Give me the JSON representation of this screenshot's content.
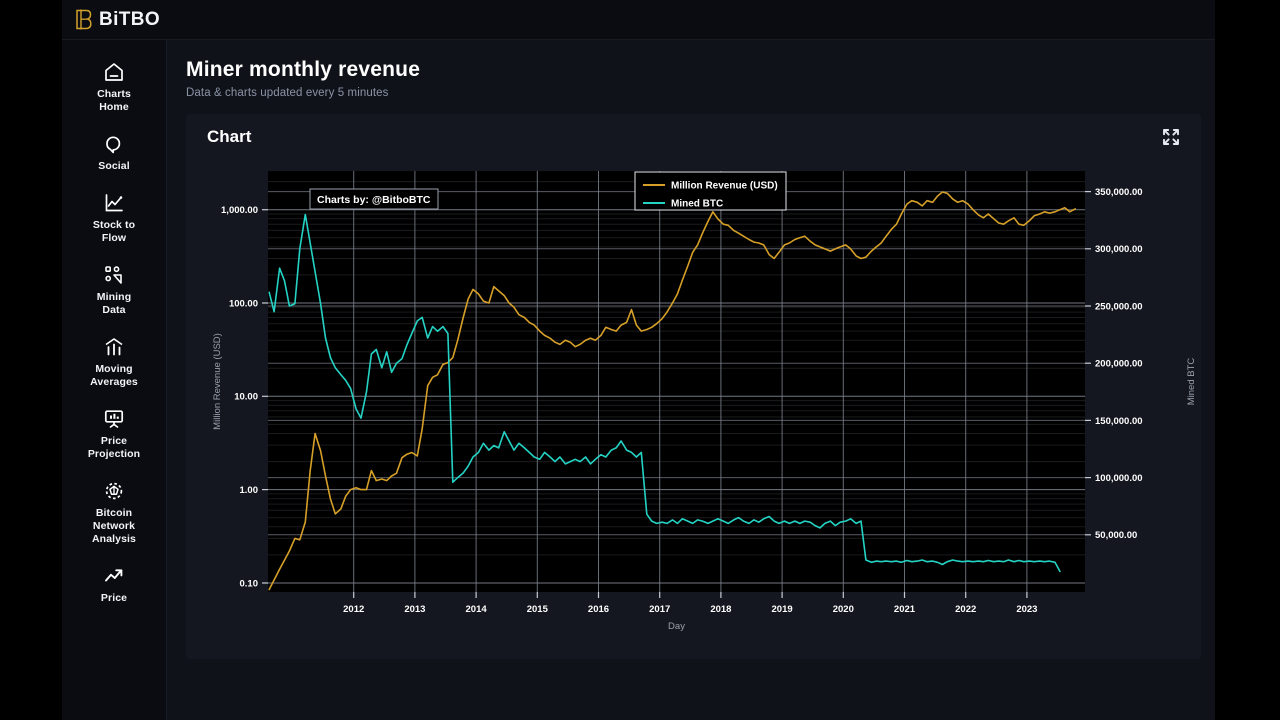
{
  "brand": {
    "name": "BiTBO",
    "logo_color": "#d4a12c"
  },
  "sidebar": {
    "items": [
      {
        "label": "Charts\nHome",
        "icon": "home-icon"
      },
      {
        "label": "Social",
        "icon": "chat-bubble-icon"
      },
      {
        "label": "Stock to\nFlow",
        "icon": "line-chart-icon"
      },
      {
        "label": "Mining\nData",
        "icon": "mining-nodes-icon"
      },
      {
        "label": "Moving\nAverages",
        "icon": "bar-chart-icon"
      },
      {
        "label": "Price\nProjection",
        "icon": "presentation-icon"
      },
      {
        "label": "Bitcoin\nNetwork\nAnalysis",
        "icon": "network-icon"
      },
      {
        "label": "Price",
        "icon": "trend-up-icon"
      }
    ]
  },
  "header": {
    "title": "Miner monthly revenue",
    "subtitle": "Data & charts updated every 5 minutes"
  },
  "card": {
    "title": "Chart",
    "expand_label": "Expand chart"
  },
  "watermark": "Charts by: @BitboBTC",
  "chart_data": {
    "type": "line",
    "title": "Miner monthly revenue",
    "xlabel": "Day",
    "ylabel": "Million Revenue (USD)",
    "y2label": "Mined BTC",
    "grid": true,
    "legend_position": "top-center",
    "yscale": "log",
    "ylim": [
      0.08,
      2600
    ],
    "yticks": [
      0.1,
      1,
      10,
      100,
      1000
    ],
    "ytick_labels": [
      "0.10",
      "1.00",
      "10.00",
      "100.00",
      "1,000.00"
    ],
    "y2scale": "linear",
    "y2lim": [
      0,
      368000
    ],
    "y2ticks": [
      50000,
      100000,
      150000,
      200000,
      250000,
      300000,
      350000
    ],
    "y2tick_labels": [
      "50,000.00",
      "100,000.00",
      "150,000.00",
      "200,000.00",
      "250,000.00",
      "300,000.00",
      "350,000.00"
    ],
    "xlim": [
      2010.6,
      2023.95
    ],
    "xticks": [
      2012,
      2013,
      2014,
      2015,
      2016,
      2017,
      2018,
      2019,
      2020,
      2021,
      2022,
      2023
    ],
    "xtick_labels": [
      "2012",
      "2013",
      "2014",
      "2015",
      "2016",
      "2017",
      "2018",
      "2019",
      "2020",
      "2021",
      "2022",
      "2023"
    ],
    "series": [
      {
        "name": "Million Revenue (USD)",
        "color": "#d6a028",
        "axis": "left",
        "x": [
          2010.62,
          2010.79,
          2010.95,
          2011.04,
          2011.12,
          2011.21,
          2011.29,
          2011.37,
          2011.46,
          2011.54,
          2011.62,
          2011.7,
          2011.79,
          2011.87,
          2011.95,
          2012.04,
          2012.12,
          2012.21,
          2012.29,
          2012.37,
          2012.46,
          2012.54,
          2012.62,
          2012.7,
          2012.79,
          2012.87,
          2012.95,
          2013.04,
          2013.12,
          2013.21,
          2013.29,
          2013.37,
          2013.46,
          2013.54,
          2013.62,
          2013.7,
          2013.79,
          2013.87,
          2013.95,
          2014.04,
          2014.12,
          2014.21,
          2014.29,
          2014.37,
          2014.46,
          2014.54,
          2014.62,
          2014.7,
          2014.79,
          2014.87,
          2014.95,
          2015.04,
          2015.12,
          2015.21,
          2015.29,
          2015.37,
          2015.46,
          2015.54,
          2015.62,
          2015.7,
          2015.79,
          2015.87,
          2015.95,
          2016.04,
          2016.12,
          2016.21,
          2016.29,
          2016.37,
          2016.46,
          2016.54,
          2016.62,
          2016.7,
          2016.79,
          2016.87,
          2016.95,
          2017.04,
          2017.12,
          2017.21,
          2017.29,
          2017.37,
          2017.46,
          2017.54,
          2017.62,
          2017.7,
          2017.79,
          2017.87,
          2017.95,
          2018.04,
          2018.12,
          2018.21,
          2018.29,
          2018.37,
          2018.46,
          2018.54,
          2018.62,
          2018.7,
          2018.79,
          2018.87,
          2018.95,
          2019.04,
          2019.12,
          2019.21,
          2019.29,
          2019.37,
          2019.46,
          2019.54,
          2019.62,
          2019.7,
          2019.79,
          2019.87,
          2019.95,
          2020.04,
          2020.12,
          2020.21,
          2020.29,
          2020.37,
          2020.46,
          2020.54,
          2020.62,
          2020.7,
          2020.79,
          2020.87,
          2020.95,
          2021.04,
          2021.12,
          2021.21,
          2021.29,
          2021.37,
          2021.46,
          2021.54,
          2021.62,
          2021.7,
          2021.79,
          2021.87,
          2021.95,
          2022.04,
          2022.12,
          2022.21,
          2022.29,
          2022.37,
          2022.46,
          2022.54,
          2022.62,
          2022.7,
          2022.79,
          2022.87,
          2022.95,
          2023.04,
          2023.12,
          2023.21,
          2023.29,
          2023.37,
          2023.46,
          2023.54,
          2023.62,
          2023.7,
          2023.79
        ],
        "y": [
          0.085,
          0.14,
          0.22,
          0.3,
          0.29,
          0.45,
          1.6,
          4.0,
          2.6,
          1.4,
          0.8,
          0.55,
          0.62,
          0.85,
          1.0,
          1.05,
          1.0,
          1.0,
          1.6,
          1.25,
          1.3,
          1.25,
          1.4,
          1.5,
          2.2,
          2.4,
          2.5,
          2.3,
          4.5,
          13.0,
          16.0,
          17.0,
          22.0,
          23.0,
          26.0,
          40.0,
          70.0,
          110.0,
          140.0,
          125.0,
          105.0,
          100.0,
          150.0,
          135.0,
          120.0,
          100.0,
          90.0,
          75.0,
          70.0,
          62.0,
          58.0,
          50.0,
          45.0,
          42.0,
          38.0,
          36.0,
          40.0,
          38.0,
          34.0,
          36.0,
          40.0,
          42.0,
          40.0,
          45.0,
          55.0,
          52.0,
          50.0,
          58.0,
          62.0,
          85.0,
          58.0,
          50.0,
          52.0,
          55.0,
          60.0,
          68.0,
          80.0,
          100.0,
          125.0,
          175.0,
          250.0,
          350.0,
          420.0,
          560.0,
          750.0,
          950.0,
          800.0,
          700.0,
          680.0,
          600.0,
          560.0,
          520.0,
          480.0,
          450.0,
          440.0,
          420.0,
          330.0,
          300.0,
          350.0,
          420.0,
          440.0,
          480.0,
          500.0,
          520.0,
          460.0,
          420.0,
          400.0,
          380.0,
          360.0,
          380.0,
          400.0,
          420.0,
          380.0,
          320.0,
          300.0,
          310.0,
          360.0,
          400.0,
          440.0,
          520.0,
          620.0,
          700.0,
          900.0,
          1150.0,
          1250.0,
          1200.0,
          1100.0,
          1250.0,
          1200.0,
          1400.0,
          1550.0,
          1500.0,
          1300.0,
          1200.0,
          1250.0,
          1150.0,
          1000.0,
          880.0,
          820.0,
          900.0,
          800.0,
          720.0,
          700.0,
          760.0,
          820.0,
          700.0,
          680.0,
          760.0,
          860.0,
          900.0,
          950.0,
          920.0,
          950.0,
          1000.0,
          1050.0,
          950.0,
          1020.0
        ]
      },
      {
        "name": "Mined BTC",
        "color": "#24d3c4",
        "axis": "right",
        "x": [
          2010.62,
          2010.7,
          2010.79,
          2010.87,
          2010.95,
          2011.04,
          2011.12,
          2011.21,
          2011.29,
          2011.37,
          2011.46,
          2011.54,
          2011.62,
          2011.7,
          2011.79,
          2011.87,
          2011.95,
          2012.04,
          2012.12,
          2012.21,
          2012.29,
          2012.37,
          2012.46,
          2012.54,
          2012.62,
          2012.7,
          2012.79,
          2012.87,
          2012.95,
          2013.04,
          2013.12,
          2013.21,
          2013.29,
          2013.37,
          2013.46,
          2013.54,
          2013.62,
          2013.7,
          2013.79,
          2013.87,
          2013.95,
          2014.04,
          2014.12,
          2014.21,
          2014.29,
          2014.37,
          2014.46,
          2014.54,
          2014.62,
          2014.7,
          2014.79,
          2014.87,
          2014.95,
          2015.04,
          2015.12,
          2015.21,
          2015.29,
          2015.37,
          2015.46,
          2015.54,
          2015.62,
          2015.7,
          2015.79,
          2015.87,
          2015.95,
          2016.04,
          2016.12,
          2016.21,
          2016.29,
          2016.37,
          2016.46,
          2016.54,
          2016.62,
          2016.7,
          2016.79,
          2016.87,
          2016.95,
          2017.04,
          2017.12,
          2017.21,
          2017.29,
          2017.37,
          2017.46,
          2017.54,
          2017.62,
          2017.7,
          2017.79,
          2017.87,
          2017.95,
          2018.04,
          2018.12,
          2018.21,
          2018.29,
          2018.37,
          2018.46,
          2018.54,
          2018.62,
          2018.7,
          2018.79,
          2018.87,
          2018.95,
          2019.04,
          2019.12,
          2019.21,
          2019.29,
          2019.37,
          2019.46,
          2019.54,
          2019.62,
          2019.7,
          2019.79,
          2019.87,
          2019.95,
          2020.04,
          2020.12,
          2020.21,
          2020.29,
          2020.37,
          2020.46,
          2020.54,
          2020.62,
          2020.7,
          2020.79,
          2020.87,
          2020.95,
          2021.04,
          2021.12,
          2021.21,
          2021.29,
          2021.37,
          2021.46,
          2021.54,
          2021.62,
          2021.7,
          2021.79,
          2021.87,
          2021.95,
          2022.04,
          2022.12,
          2022.21,
          2022.29,
          2022.37,
          2022.46,
          2022.54,
          2022.62,
          2022.7,
          2022.79,
          2022.87,
          2022.95,
          2023.04,
          2023.12,
          2023.21,
          2023.29,
          2023.37,
          2023.46,
          2023.54,
          2023.62,
          2023.7,
          2023.79,
          2023.85
        ],
        "y": [
          262000,
          245000,
          283000,
          272000,
          250000,
          252000,
          300000,
          330000,
          305000,
          280000,
          252000,
          222000,
          205000,
          196000,
          190000,
          185000,
          178000,
          160000,
          152000,
          175000,
          208000,
          212000,
          196000,
          210000,
          192000,
          200000,
          204000,
          216000,
          226000,
          237000,
          240000,
          222000,
          232000,
          228000,
          232000,
          226000,
          96000,
          100000,
          104000,
          110000,
          118000,
          122000,
          130000,
          124000,
          128000,
          126000,
          140000,
          132000,
          124000,
          130000,
          126000,
          122000,
          118000,
          116000,
          122000,
          118000,
          114000,
          118000,
          112000,
          114000,
          116000,
          114000,
          118000,
          112000,
          116000,
          120000,
          118000,
          124000,
          126000,
          132000,
          124000,
          122000,
          118000,
          122000,
          68000,
          62000,
          60000,
          61000,
          60000,
          63000,
          60000,
          64000,
          62000,
          60000,
          63000,
          62000,
          60000,
          62000,
          64000,
          62000,
          60000,
          63000,
          65000,
          62000,
          60000,
          63000,
          61000,
          64000,
          66000,
          62000,
          60000,
          62000,
          60000,
          62000,
          60000,
          62000,
          61000,
          58000,
          56000,
          60000,
          62000,
          58000,
          61000,
          62000,
          64000,
          60000,
          62000,
          28000,
          26000,
          27000,
          26500,
          27000,
          26500,
          27000,
          26000,
          27500,
          26500,
          27000,
          28000,
          26500,
          27000,
          26000,
          24000,
          26500,
          28000,
          27000,
          26500,
          27000,
          26500,
          27000,
          26500,
          27500,
          26500,
          27000,
          26500,
          28000,
          26500,
          27500,
          26500,
          27000,
          26500,
          27000,
          26500,
          27000,
          26000,
          18000
        ]
      }
    ]
  }
}
